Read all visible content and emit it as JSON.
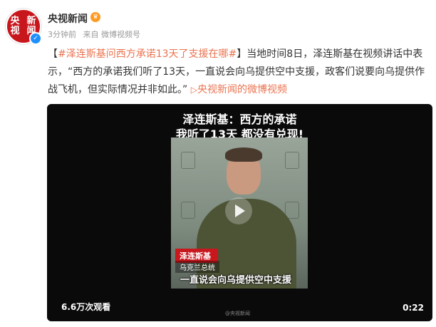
{
  "author": {
    "name": "央视新闻",
    "avatar_lines": [
      "央视",
      "新闻"
    ],
    "verified_icon": "verified-badge-icon",
    "vip_icon": "crown-icon"
  },
  "meta": {
    "time": "3分钟前",
    "source": "来自 微博视频号"
  },
  "post": {
    "open_bracket": "【",
    "hashtag": "#泽连斯基问西方承诺13天了支援在哪#",
    "close_bracket": "】",
    "body": "当地时间8日，泽连斯基在视频讲话中表示，“西方的承诺我们听了13天，一直说会向乌提供空中支援，政客们说要向乌提供作战飞机，但实际情况并非如此。”",
    "video_link_icon": "video-play-icon",
    "video_link": "央视新闻的微博视频"
  },
  "video": {
    "overlay_line1": "泽连斯基：西方的承诺",
    "overlay_line2": "我听了13天 都没有兑现!",
    "name_tag": "泽连斯基",
    "title_tag": "乌克兰总统",
    "subtitle": "一直说会向乌提供空中支援",
    "views": "6.6万次观看",
    "duration": "0:22",
    "watermark": "@央视新闻"
  }
}
